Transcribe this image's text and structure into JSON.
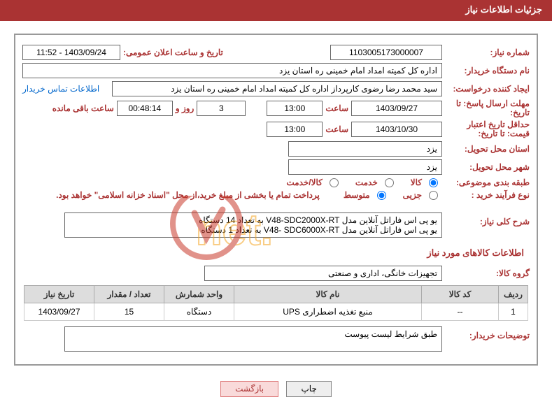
{
  "header": {
    "title": "جزئیات اطلاعات نیاز"
  },
  "need_number": {
    "label": "شماره نیاز:",
    "value": "1103005173000007"
  },
  "announce": {
    "label": "تاریخ و ساعت اعلان عمومی:",
    "value": "1403/09/24 - 11:52"
  },
  "buyer_name": {
    "label": "نام دستگاه خریدار:",
    "value": "اداره کل کمیته امداد امام خمینی  ره  استان یزد"
  },
  "requester": {
    "label": "ایجاد کننده درخواست:",
    "value": "سید محمد رضا رضوی کارپرداز اداره کل کمیته امداد امام خمینی  ره  استان یزد"
  },
  "contact_link": "اطلاعات تماس خریدار",
  "deadline": {
    "label": "مهلت ارسال پاسخ: تا تاریخ:",
    "date": "1403/09/27",
    "time_label": "ساعت",
    "time": "13:00",
    "days": "3",
    "days_label": "روز و",
    "remain": "00:48:14",
    "remain_label": "ساعت باقی مانده"
  },
  "validity": {
    "label": "حداقل تاریخ اعتبار قیمت: تا تاریخ:",
    "date": "1403/10/30",
    "time_label": "ساعت",
    "time": "13:00"
  },
  "delivery_province": {
    "label": "استان محل تحویل:",
    "value": "یزد"
  },
  "delivery_city": {
    "label": "شهر محل تحویل:",
    "value": "یزد"
  },
  "category": {
    "label": "طبقه بندی موضوعی:",
    "opt1": "کالا",
    "opt2": "خدمت",
    "opt3": "کالا/خدمت"
  },
  "process": {
    "label": "نوع فرآیند خرید :",
    "opt1": "جزیی",
    "opt2": "متوسط",
    "note": "پرداخت تمام یا بخشی از مبلغ خرید،از محل \"اسناد خزانه اسلامی\" خواهد بود."
  },
  "overall_desc": {
    "label": "شرح کلی نیاز:",
    "line1": "یو پی اس فاراتل آنلاین مدل V48-SDC2000X-RT   به تعداد 14 دستگاه",
    "line2": "یو پی اس فاراتل آنلاین مدل V48- SDC6000X-RT به تعداد 1 دستگاه"
  },
  "section2": "اطلاعات کالاهای مورد نیاز",
  "goods_group": {
    "label": "گروه کالا:",
    "value": "تجهیزات خانگی، اداری و صنعتی"
  },
  "table": {
    "headers": {
      "row": "ردیف",
      "code": "کد کالا",
      "name": "نام کالا",
      "unit": "واحد شمارش",
      "qty": "تعداد / مقدار",
      "date": "تاریخ نیاز"
    },
    "r1": {
      "row": "1",
      "code": "--",
      "name": "منبع تغذیه اضطراری UPS",
      "unit": "دستگاه",
      "qty": "15",
      "date": "1403/09/27"
    }
  },
  "buyer_notes": {
    "label": "توضیحات خریدار:",
    "value": "طبق شرایط لیست پیوست"
  },
  "buttons": {
    "print": "چاپ",
    "back": "بازگشت"
  }
}
